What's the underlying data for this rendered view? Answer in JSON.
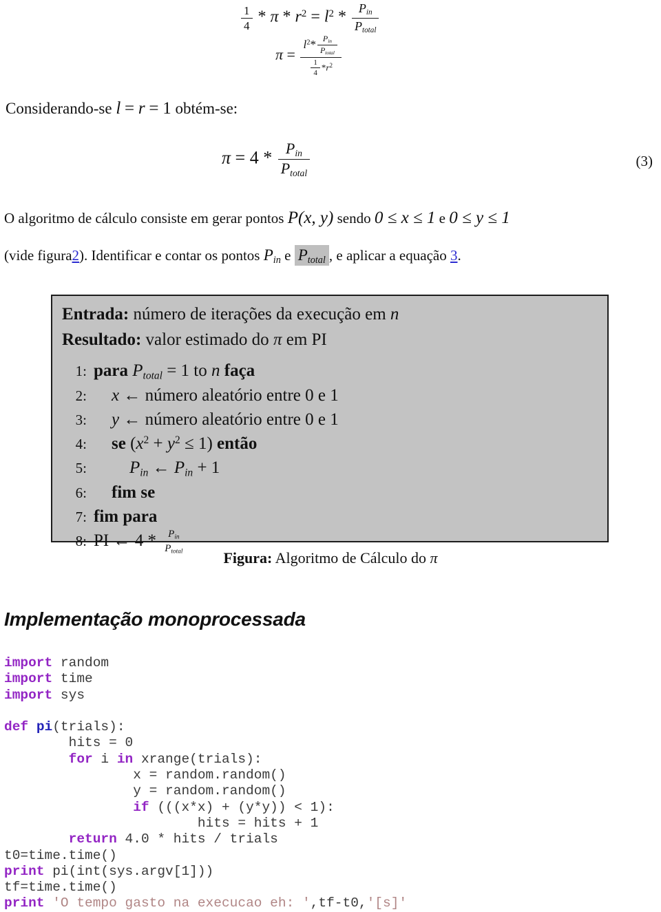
{
  "equations": {
    "top": {
      "line1": {
        "lhs_frac_num": "1",
        "lhs_frac_den": "4",
        "op1": "*",
        "pi": "π",
        "op2": "*",
        "r": "r",
        "r_exp": "2",
        "equals": "=",
        "l": "l",
        "l_exp": "2",
        "op3": "*",
        "rhs_num_P": "P",
        "rhs_num_sub": "in",
        "rhs_den_P": "P",
        "rhs_den_sub": "total"
      },
      "line2": {
        "pi": "π",
        "equals": "=",
        "num_l": "l",
        "num_l_exp": "2",
        "num_op": "*",
        "num_in_P": "P",
        "num_in_sub": "in",
        "num_tot_P": "P",
        "num_tot_sub": "total",
        "den_frac_num": "1",
        "den_frac_den": "4",
        "den_op": "*",
        "den_r": "r",
        "den_r_exp": "2"
      }
    },
    "eq3": {
      "pi": "π",
      "equals": "=",
      "coef": "4",
      "op": "*",
      "num_P": "P",
      "num_sub": "in",
      "den_P": "P",
      "den_sub": "total",
      "number": "(3)"
    }
  },
  "paragraphs": {
    "considerando": {
      "text_before": "Considerando-se",
      "math_l": "l",
      "eq1": "=",
      "math_r": "r",
      "eq2": "=",
      "one": "1",
      "text_after": "obtém-se:"
    },
    "algoritmo": {
      "text_before": "O algoritmo de cálculo consiste em gerar pontos",
      "point": "P(x, y)",
      "sendo": "sendo",
      "range_x": "0 ≤ x ≤ 1",
      "e": "e",
      "range_y": "0 ≤ y ≤ 1"
    },
    "vide": {
      "prefix": "(vide figura",
      "link_figura": "2",
      "mid1": "). Identificar e contar os pontos",
      "p_in_P": "P",
      "p_in_sub": "in",
      "e": "e",
      "p_total_P": "P",
      "p_total_sub": "total",
      "mid2": ", e aplicar a equação",
      "link_equacao": "3",
      "suffix": "."
    }
  },
  "algorithm": {
    "entrada_label": "Entrada:",
    "entrada_text": "número de iterações da execução em",
    "entrada_var": "n",
    "resultado_label": "Resultado:",
    "resultado_text_a": "valor estimado do",
    "resultado_pi": "π",
    "resultado_text_b": "em PI",
    "lines": [
      {
        "num": "1:",
        "indent": 1,
        "kw_a": "para",
        "var_P": "P",
        "var_sub": "total",
        "mid": "= 1 to",
        "var_n": "n",
        "kw_b": "faça"
      },
      {
        "num": "2:",
        "indent": 2,
        "var": "x",
        "arrow": "←",
        "text": "número aleatório entre 0 e 1"
      },
      {
        "num": "3:",
        "indent": 2,
        "var": "y",
        "arrow": "←",
        "text": "número aleatório entre 0 e 1"
      },
      {
        "num": "4:",
        "indent": 2,
        "kw_a": "se",
        "cond_open": "(",
        "cond_x": "x",
        "cond_x_exp": "2",
        "cond_plus": "+",
        "cond_y": "y",
        "cond_y_exp": "2",
        "cond_le": "≤ 1",
        "cond_close": ")",
        "kw_b": "então"
      },
      {
        "num": "5:",
        "indent": 3,
        "lhs_P": "P",
        "lhs_sub": "in",
        "arrow": "←",
        "rhs_P": "P",
        "rhs_sub": "in",
        "rhs_tail": "+ 1"
      },
      {
        "num": "6:",
        "indent": 2,
        "kw_a": "fim se"
      },
      {
        "num": "7:",
        "indent": 1,
        "kw_a": "fim para"
      },
      {
        "num": "8:",
        "indent": 1,
        "pi_label": "PI",
        "arrow": "←",
        "coef": "4 *",
        "num_P": "P",
        "num_sub": "in",
        "den_P": "P",
        "den_sub": "total"
      }
    ]
  },
  "figure_caption": {
    "label": "Figura:",
    "text": "Algoritmo de Cálculo do",
    "pi": "π"
  },
  "section_heading": "Implementação monoprocessada",
  "code": {
    "language": "python",
    "colors": {
      "keyword": "#9325c4",
      "function": "#2222b8",
      "string": "#b08585",
      "plain": "#3a3a3a"
    },
    "lines": [
      [
        {
          "t": "import",
          "c": "kw"
        },
        {
          "t": " random",
          "c": "txt"
        }
      ],
      [
        {
          "t": "import",
          "c": "kw"
        },
        {
          "t": " time",
          "c": "txt"
        }
      ],
      [
        {
          "t": "import",
          "c": "kw"
        },
        {
          "t": " sys",
          "c": "txt"
        }
      ],
      [
        {
          "t": "",
          "c": "txt"
        }
      ],
      [
        {
          "t": "def",
          "c": "kw"
        },
        {
          "t": " ",
          "c": "txt"
        },
        {
          "t": "pi",
          "c": "fn"
        },
        {
          "t": "(trials):",
          "c": "txt"
        }
      ],
      [
        {
          "t": "        hits = 0",
          "c": "txt"
        }
      ],
      [
        {
          "t": "        ",
          "c": "txt"
        },
        {
          "t": "for",
          "c": "kw"
        },
        {
          "t": " i ",
          "c": "txt"
        },
        {
          "t": "in",
          "c": "kw"
        },
        {
          "t": " xrange(trials):",
          "c": "txt"
        }
      ],
      [
        {
          "t": "                x = random.random()",
          "c": "txt"
        }
      ],
      [
        {
          "t": "                y = random.random()",
          "c": "txt"
        }
      ],
      [
        {
          "t": "                ",
          "c": "txt"
        },
        {
          "t": "if",
          "c": "kw"
        },
        {
          "t": " (((x*x) + (y*y)) < 1):",
          "c": "txt"
        }
      ],
      [
        {
          "t": "                        hits = hits + 1",
          "c": "txt"
        }
      ],
      [
        {
          "t": "        ",
          "c": "txt"
        },
        {
          "t": "return",
          "c": "kw"
        },
        {
          "t": " 4.0 * hits / trials",
          "c": "txt"
        }
      ],
      [
        {
          "t": "t0=time.time()",
          "c": "txt"
        }
      ],
      [
        {
          "t": "print",
          "c": "kw"
        },
        {
          "t": " pi(int(sys.argv[1]))",
          "c": "txt"
        }
      ],
      [
        {
          "t": "tf=time.time()",
          "c": "txt"
        }
      ],
      [
        {
          "t": "print",
          "c": "kw"
        },
        {
          "t": " ",
          "c": "txt"
        },
        {
          "t": "'O tempo gasto na execucao eh: '",
          "c": "str"
        },
        {
          "t": ",tf-t0,",
          "c": "txt"
        },
        {
          "t": "'[s]'",
          "c": "str"
        }
      ]
    ]
  }
}
